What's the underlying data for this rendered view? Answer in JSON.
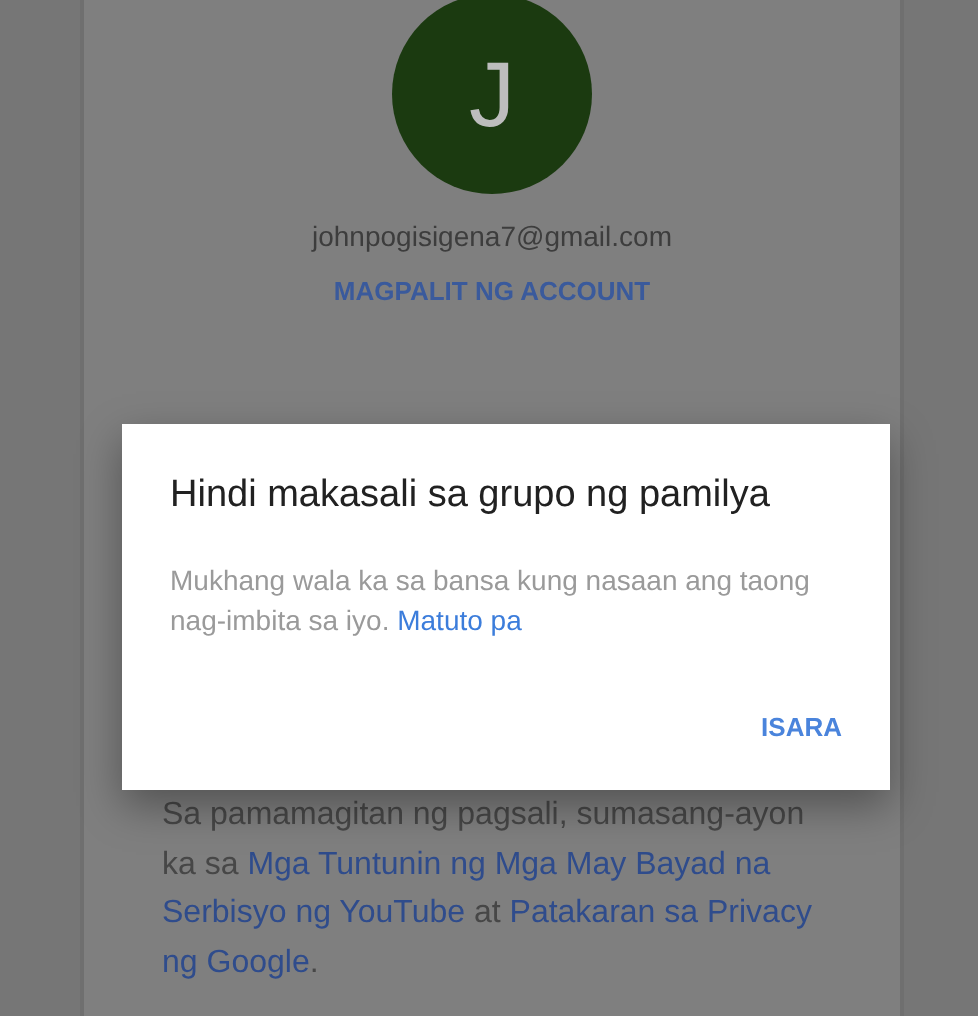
{
  "account": {
    "avatar_letter": "J",
    "email": "johnpogisigena7@gmail.com",
    "switch_link": "MAGPALIT NG ACCOUNT"
  },
  "legal": [
    {
      "kind": "text",
      "text": "Sa pamamagitan ng pagsali, sumasang-ayon ka sa "
    },
    {
      "kind": "link",
      "text": "Mga Tuntunin ng Mga May Bayad na Serbisyo ng YouTube"
    },
    {
      "kind": "text",
      "text": " at "
    },
    {
      "kind": "link",
      "text": "Patakaran sa Privacy ng Google"
    },
    {
      "kind": "text",
      "text": "."
    }
  ],
  "dialog": {
    "title": "Hindi makasali sa grupo ng pamilya",
    "message": "Mukhang wala ka sa bansa kung nasaan ang taong nag-imbita sa iyo.",
    "link": "Matuto pa",
    "button": "ISARA"
  }
}
